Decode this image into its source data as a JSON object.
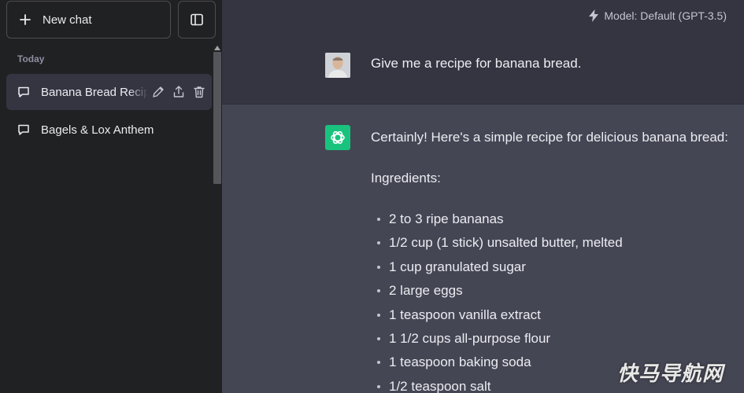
{
  "sidebar": {
    "new_chat_label": "New chat",
    "section_label": "Today",
    "chats": [
      {
        "title": "Banana Bread Recipe"
      },
      {
        "title": "Bagels & Lox Anthem"
      }
    ]
  },
  "header": {
    "model_label": "Model: Default (GPT-3.5)"
  },
  "conversation": {
    "user_message": "Give me a recipe for banana bread.",
    "assistant": {
      "intro": "Certainly! Here's a simple recipe for delicious banana bread:",
      "ingredients_heading": "Ingredients:",
      "ingredients": [
        "2 to 3 ripe bananas",
        "1/2 cup (1 stick) unsalted butter, melted",
        "1 cup granulated sugar",
        "2 large eggs",
        "1 teaspoon vanilla extract",
        "1 1/2 cups all-purpose flour",
        "1 teaspoon baking soda",
        "1/2 teaspoon salt"
      ]
    }
  },
  "watermark": "快马导航网",
  "colors": {
    "sidebar_bg": "#202123",
    "main_bg": "#343541",
    "assistant_bg": "#444654",
    "bot_avatar": "#19c37d"
  },
  "icons": [
    "plus-icon",
    "sidebar-toggle-icon",
    "chat-bubble-icon",
    "edit-icon",
    "share-icon",
    "trash-icon",
    "bolt-icon",
    "openai-logo-icon"
  ]
}
